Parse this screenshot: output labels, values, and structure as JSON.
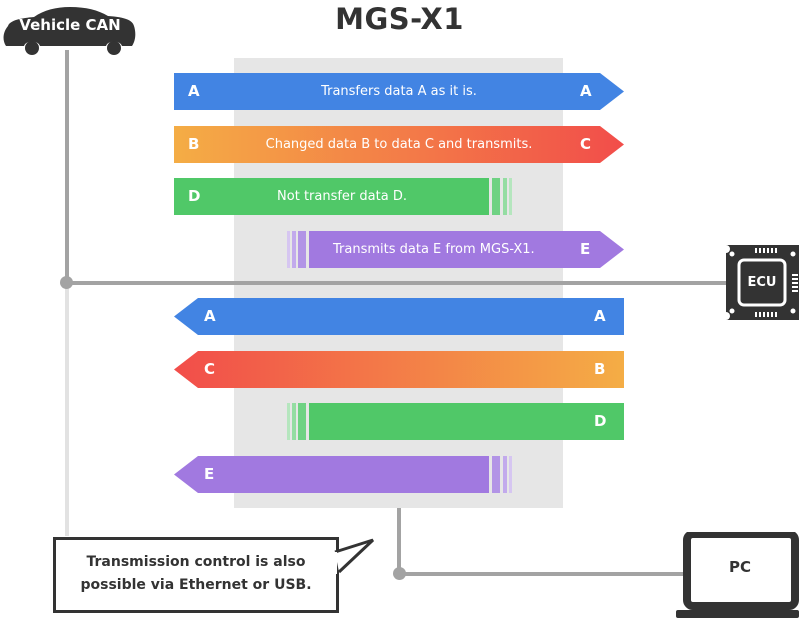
{
  "title": "MGS-X1",
  "nodes": {
    "vehicle_can": "Vehicle CAN",
    "ecu": "ECU",
    "pc": "PC"
  },
  "callout": {
    "line1": "Transmission control is also",
    "line2": "possible via Ethernet or USB."
  },
  "colors": {
    "blue": "#4284e3",
    "orange": "#f4ad45",
    "red": "#f24d4a",
    "green": "#50c868",
    "purple": "#a179e0",
    "panel": "#e6e6e6",
    "line": "#a3a3a3",
    "dark": "#333333"
  },
  "downstream": [
    {
      "in": "A",
      "out": "A",
      "message": "Transfers data A as it is."
    },
    {
      "in": "B",
      "out": "C",
      "message": "Changed data B to data C and transmits."
    },
    {
      "in": "D",
      "out": "",
      "message": "Not transfer data D."
    },
    {
      "in": "",
      "out": "E",
      "message": "Transmits data E from MGS-X1."
    }
  ],
  "upstream": [
    {
      "in": "A",
      "out": "A"
    },
    {
      "in": "B",
      "out": "C"
    },
    {
      "in": "D",
      "out": ""
    },
    {
      "in": "",
      "out": "E"
    }
  ]
}
